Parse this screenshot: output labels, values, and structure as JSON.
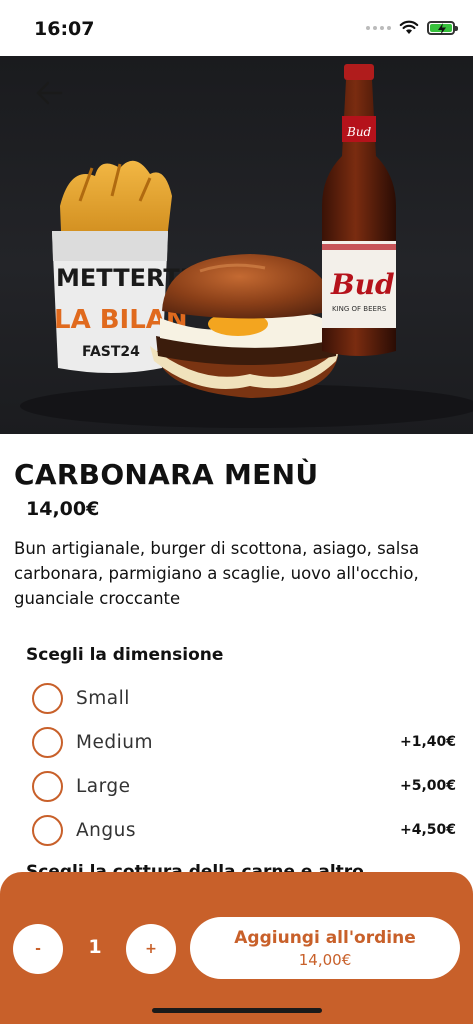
{
  "status_bar": {
    "time": "16:07"
  },
  "hero": {
    "back_icon": "arrow-left-icon",
    "cup_text_line1": "METTERTI A",
    "cup_text_line2": "LA BILAN",
    "cup_logo": "FAST24",
    "bottle_label": "Bud",
    "bottle_sublabel": "KING OF BEERS"
  },
  "product": {
    "title": "CARBONARA MENÙ",
    "price": "14,00€",
    "description": "Bun artigianale, burger di scottona, asiago, salsa carbonara, parmigiano a scaglie, uovo all'occhio, guanciale croccante"
  },
  "size_section": {
    "title": "Scegli la dimensione",
    "options": [
      {
        "label": "Small",
        "price": ""
      },
      {
        "label": "Medium",
        "price": "+1,40€"
      },
      {
        "label": "Large",
        "price": "+5,00€"
      },
      {
        "label": "Angus",
        "price": "+4,50€"
      }
    ]
  },
  "next_section": {
    "title": "Scegli la cottura della carne e altro"
  },
  "order_bar": {
    "minus_label": "-",
    "quantity": "1",
    "plus_label": "+",
    "add_label": "Aggiungi all'ordine",
    "add_price": "14,00€"
  },
  "colors": {
    "accent": "#c8602a",
    "battery": "#37c13c"
  }
}
